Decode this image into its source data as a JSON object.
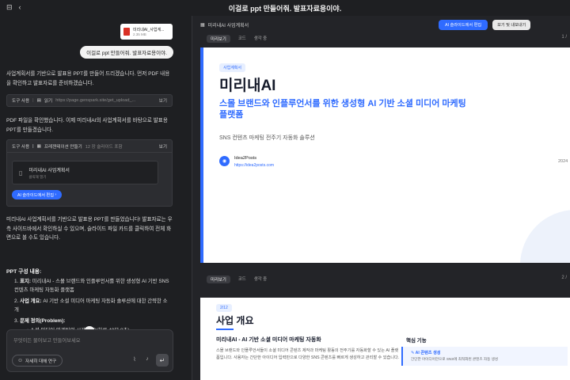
{
  "header": {
    "title": "이걸로 ppt 만들어줘. 발표자료용이야."
  },
  "chat": {
    "file": {
      "name": "미리내AI_사업계...",
      "size": "2.35 MB"
    },
    "user_message": "이걸로 ppt 만들어줘. 발표자료용이야.",
    "reply1": "사업계획서를 기반으로 발표용 PPT를 만들어 드리겠습니다. 먼저 PDF 내용을 확인하고 발표자료를 준비하겠습니다.",
    "tool1": {
      "label": "도구 사용",
      "action": "읽기",
      "url": "https://page.genspark.site/get_upload_...",
      "view": "보기"
    },
    "reply2": "PDF 파일을 확인했습니다. 이제 미리내AI의 사업계획서를 바탕으로 발표용 PPT를 만들겠습니다.",
    "tool2": {
      "label": "도구 사용",
      "action": "프레젠테이션 만들기",
      "detail": "12 장 슬라이드 포함",
      "view": "보기",
      "card_title": "미리내AI 사업계획서",
      "card_sub": "클릭해 열기",
      "edit_label": "AI 슬라이드에서 편집"
    },
    "reply3": "미리내AI 사업계획서를 기반으로 발표용 PPT를 만들었습니다! 발표자료는 우측 사이드바에서 확인하실 수 있으며, 슬라이드 파일 카드를 클릭하여 전체 화면으로 볼 수도 있습니다.",
    "outline_title": "PPT 구성 내용:",
    "outline": [
      {
        "num": "1.",
        "head": "표지:",
        "text": " 미리내AI - 스몰 브랜드와 인플루언서를 위한 생성형 AI 기반 SNS 컨텐츠 마케팅 자동화 플랫폼"
      },
      {
        "num": "2.",
        "head": "사업 개요:",
        "text": " AI 기반 소셜 미디어 마케팅 자동화 솔루션에 대한 간략한 소개"
      },
      {
        "num": "3.",
        "head": "문제 정의(Problem):",
        "text": ""
      }
    ],
    "outline_sub": "• 소셜 미디어 마케팅의 시간 소요(하루 48분 8초)",
    "input_placeholder": "무엇이든 물어보고 만들어보세요",
    "research_label": "자세히 대해 연구"
  },
  "preview": {
    "title": "미리내AI 사업계획서",
    "edit_button": "AI 슬라이드에서 편집",
    "download_button": "보기 및 내보내기",
    "tabs": [
      "미리보기",
      "코드",
      "생각 중"
    ],
    "page1": "1 /",
    "page2": "2 /",
    "slide1": {
      "badge": "사업계획서",
      "title": "미리내AI",
      "subtitle": "스몰 브랜드와 인플루언서를 위한 생성형 AI 기반 소셜 미디어 마케팅 플랫폼",
      "desc": "SNS 컨텐츠 마케팅 전주기 자동화 솔루션",
      "brand": "Idea2Posts",
      "url": "https://idea2posts.com",
      "year": "2024"
    },
    "slide2": {
      "badge": "2/12",
      "title": "사업 개요",
      "heading": "미리내AI - AI 기반 소셜 미디어 마케팅 자동화",
      "para": "스몰 브랜드와 인플루언서들이 소셜 미디어 콘텐츠 제작과 마케팅 활동의 전주기를 자동화할 수 있는 AI 플랫폼입니다. 사용자는 간단한 아이디어 입력만으로 다양한 SNS 콘텐츠를 빠르게 생성하고 관리할 수 있습니다.",
      "key_title": "핵심 기능",
      "card_title": "AI 콘텐츠 생성",
      "card_desc": "간단한 아이디어만으로 SNS에 최적화된 콘텐츠 자동 생성"
    }
  }
}
